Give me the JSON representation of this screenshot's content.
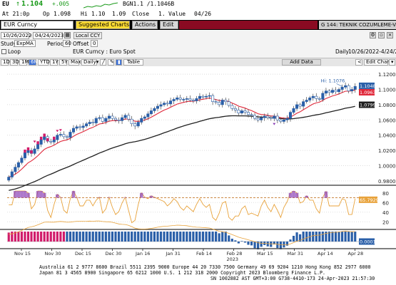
{
  "quote": {
    "ticker": "EU",
    "last": "1.104",
    "change": "+.005",
    "bgn": "BGN1.1 /1.1046B",
    "at": "At 21:0p",
    "open_label": "Op",
    "open": "1.098",
    "high_label": "Hi",
    "high": "1.10",
    "low": "1.09",
    "close_label": "Close",
    "close": "1.",
    "value_label": "Value",
    "date": "04/26"
  },
  "toolbar": {
    "security": "EUR Curncy",
    "suggested": "Suggested Charts",
    "actions": "Actions",
    "edit": "Edit",
    "title": "G 144: TEKNIK COZUMLEME-V1"
  },
  "settings": {
    "date_from": "10/26/2022",
    "date_to": "04/24/2023",
    "currency": "Local CCY",
    "study_label": "Study",
    "study_value": "ExpMA",
    "period_label": "Period",
    "period_value": "60",
    "offset_label": "Offset",
    "offset_value": "0",
    "loop_label": "Loop",
    "security_desc": "EUR Curncy : Euro Spot",
    "add_data": "Add Data",
    "freq_label": "Daily",
    "range_text": "10/26/2022-4/24/2023",
    "ranges": [
      "1D",
      "3D",
      "1M",
      "6M",
      "YTD",
      "1Y",
      "5Y",
      "Max"
    ],
    "active_range": "6M",
    "period_select": "Daily",
    "table_label": "Table",
    "edit_chart": "Edit Chart"
  },
  "chart_data": {
    "type": "candlestick",
    "price_panel": {
      "y_ticks": [
        "1.1200",
        "1.1000",
        "1.0800",
        "1.0600",
        "1.0400",
        "1.0200",
        "1.0000",
        "0.9800"
      ],
      "ylim": [
        0.978,
        1.122
      ],
      "last_price_tag": "1.1048",
      "ma_short_tag": "1.0963",
      "ma_long_tag": "1.0799",
      "hi_annotation": "Hi: 1.1076",
      "colors": {
        "up": "#2a5fa8",
        "down": "#2a5fa8",
        "ma_short": "#e0283a",
        "ma_long": "#202020",
        "marker": "#d01b6a"
      },
      "closes": [
        0.985,
        0.992,
        0.998,
        1.004,
        1.01,
        1.017,
        1.02,
        1.016,
        1.022,
        1.028,
        1.034,
        1.038,
        1.032,
        1.031,
        1.034,
        1.04,
        1.041,
        1.038,
        1.037,
        1.044,
        1.049,
        1.051,
        1.05,
        1.052,
        1.055,
        1.057,
        1.056,
        1.062,
        1.063,
        1.058,
        1.062,
        1.065,
        1.062,
        1.06,
        1.059,
        1.063,
        1.066,
        1.061,
        1.055,
        1.052,
        1.057,
        1.062,
        1.064,
        1.068,
        1.072,
        1.075,
        1.078,
        1.08,
        1.082,
        1.081,
        1.085,
        1.087,
        1.089,
        1.087,
        1.087,
        1.088,
        1.086,
        1.085,
        1.088,
        1.091,
        1.09,
        1.091,
        1.092,
        1.084,
        1.083,
        1.08,
        1.086,
        1.084,
        1.079,
        1.075,
        1.073,
        1.069,
        1.072,
        1.07,
        1.067,
        1.066,
        1.062,
        1.06,
        1.063,
        1.065,
        1.063,
        1.062,
        1.065,
        1.06,
        1.058,
        1.06,
        1.062,
        1.07,
        1.075,
        1.08,
        1.078,
        1.084,
        1.086,
        1.089,
        1.091,
        1.088,
        1.087,
        1.095,
        1.098,
        1.096,
        1.099,
        1.097,
        1.1,
        1.103,
        1.105,
        1.098,
        1.1,
        1.104
      ]
    },
    "rsi_panel": {
      "y_ticks": [
        "80",
        "60",
        "40",
        "20"
      ],
      "ylim": [
        10,
        90
      ],
      "last_tag": "65.7929",
      "color": "#e8a23a"
    },
    "macd_panel": {
      "last_tag": "0.0001",
      "color_up": "#d01b6a",
      "color_bars": "#2a5fa8"
    },
    "x_ticks": [
      "Nov 15",
      "Nov 30",
      "Dec 15",
      "Dec 30",
      "Jan 16",
      "Jan 31",
      "Feb 14",
      "Feb 28",
      "Mar 15",
      "Mar 31",
      "Apr 14",
      "Apr 28"
    ],
    "x_year_label": "2023"
  },
  "footer": {
    "line1": "Australia 61 2 9777 8600 Brazil 5511 2395 9000 Europe 44 20 7330 7500 Germany 49 69 9204 1210 Hong Kong 852 2977 6000",
    "line2": "Japan 81 3 4565 8900         Singapore 65 6212 1000         U.S. 1 212 318 2000        Copyright 2023 Bloomberg Finance L.P.",
    "line3": "SN 1002882 AST  GMT+3:00 G738-4410-173 24-Apr-2023 21:57:30"
  }
}
